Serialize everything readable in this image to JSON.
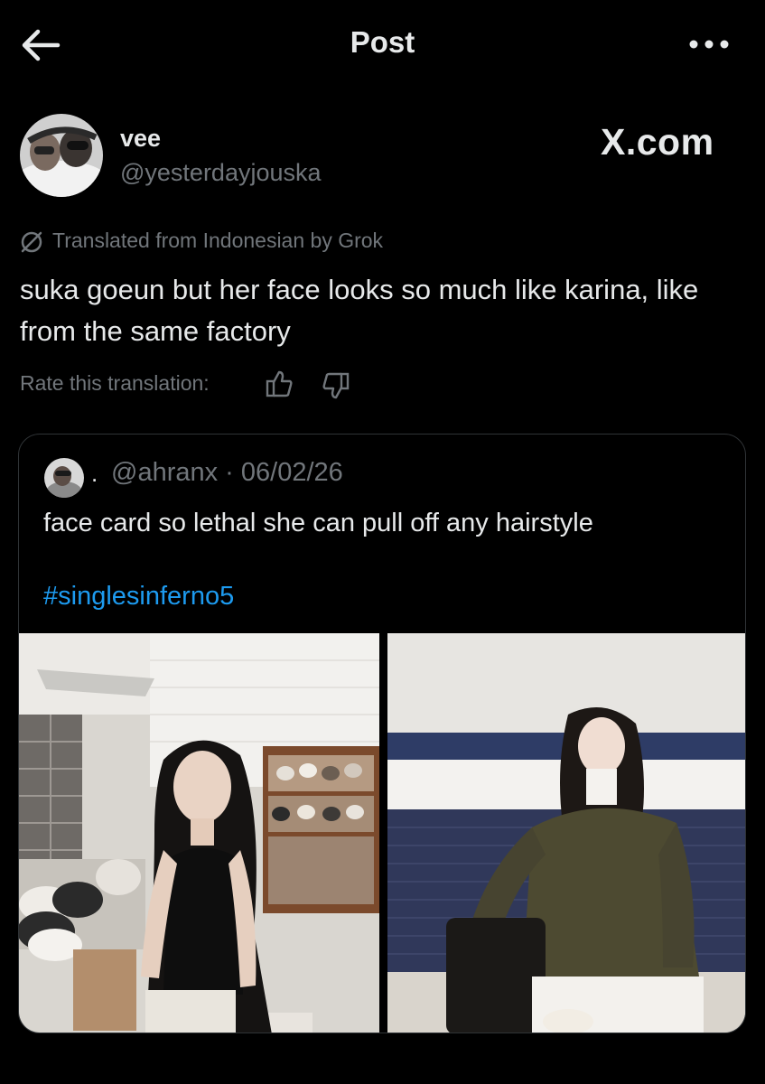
{
  "header": {
    "title": "Post",
    "back_icon": "arrow-left-icon",
    "more_icon": "more-horizontal-icon"
  },
  "author": {
    "name": "vee",
    "handle": "@yesterdayjouska",
    "watermark": "X.com"
  },
  "translation": {
    "notice": "Translated from Indonesian by Grok",
    "text": "suka goeun but her face looks so much like karina, like from the same factory",
    "rate_label": "Rate this translation:"
  },
  "quote": {
    "dot": ".",
    "meta": "@ahranx · 06/02/26",
    "text": "face card so lethal she can pull off any hairstyle",
    "hashtag": "#singlesinferno5"
  },
  "colors": {
    "background": "#000000",
    "primary_text": "#e7e9ea",
    "secondary_text": "#71767b",
    "link": "#1d9bf0",
    "border": "#2f3336"
  }
}
